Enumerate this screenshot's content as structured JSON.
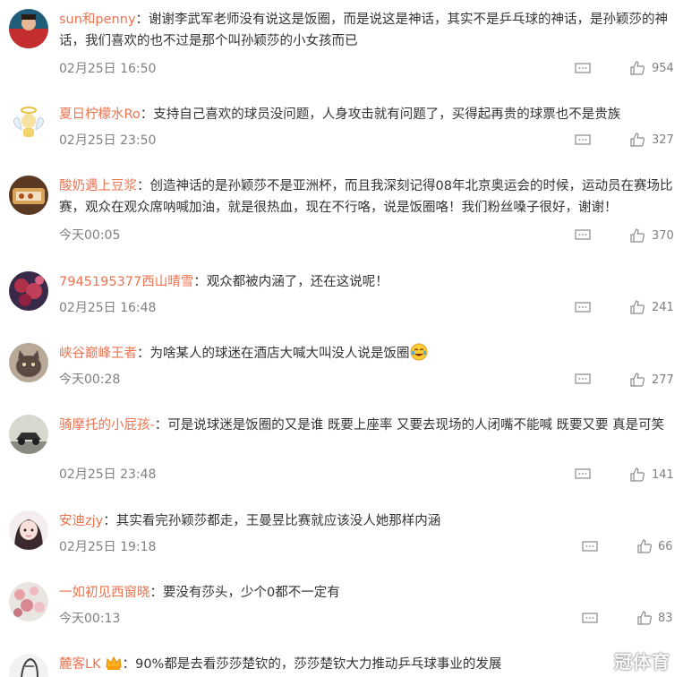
{
  "comments": [
    {
      "user": "sun和penny",
      "sep": "：",
      "text": "谢谢李武军老师没有说这是饭圈，而是说这是神话，其实不是乒乓球的神话，是孙颖莎的神话，我们喜欢的也不过是那个叫孙颖莎的小女孩而已",
      "time": "02月25日 16:50",
      "likes": "954",
      "avatar": "avatar-red-sports"
    },
    {
      "user": "夏日柠檬水Ro",
      "sep": "：",
      "text": "支持自己喜欢的球员没问题，人身攻击就有问题了，买得起再贵的球票也不是贵族",
      "time": "02月25日 23:50",
      "likes": "327",
      "avatar": "avatar-angel"
    },
    {
      "user": "酸奶遇上豆浆",
      "sep": "：",
      "text": "创造神话的是孙颖莎不是亚洲杯，而且我深刻记得08年北京奥运会的时候，运动员在赛场比赛，观众在观众席呐喊加油，就是很热血，现在不行咯，说是饭圈咯！我们粉丝嗓子很好，谢谢！",
      "time": "今天00:05",
      "likes": "370",
      "avatar": "avatar-food"
    },
    {
      "user": "7945195377西山晴雪",
      "sep": "：",
      "text": "观众都被内涵了，还在这说呢！",
      "time": "02月25日 16:48",
      "likes": "241",
      "avatar": "avatar-flowers"
    },
    {
      "user": "峡谷巅峰王者",
      "sep": "：",
      "text": "为啥某人的球迷在酒店大喊大叫没人说是饭圈",
      "time": "今天00:28",
      "likes": "277",
      "avatar": "avatar-cat",
      "emoji": "crying-laughing-emoji"
    },
    {
      "user": "骑摩托的小屁孩-",
      "sep": "：",
      "text": "可是说球迷是饭圈的又是谁 既要上座率 又要去现场的人闭嘴不能喊 既要又要 真是可笑",
      "time": "02月25日 23:48",
      "likes": "141",
      "avatar": "avatar-car"
    },
    {
      "user": "安迪zjy",
      "sep": "：",
      "text": "其实看完孙颖莎都走，王曼昱比赛就应该没人她那样内涵",
      "time": "02月25日 19:18",
      "likes": "66",
      "avatar": "avatar-girl"
    },
    {
      "user": "一如初见西窗晓",
      "sep": "：",
      "text": "要没有莎头，少个0都不一定有",
      "time": "今天00:13",
      "likes": "83",
      "avatar": "avatar-blossom"
    },
    {
      "user": "麓客LK",
      "sep": "：",
      "text": "90%都是去看莎莎楚钦的，莎莎楚钦大力推动乒乓球事业的发展",
      "time": "",
      "likes": "",
      "avatar": "avatar-sketch",
      "badge": "crown-icon"
    }
  ],
  "watermark": "冠体育",
  "colors": {
    "username": "#eb7350",
    "text": "#333333",
    "meta": "#808080"
  }
}
